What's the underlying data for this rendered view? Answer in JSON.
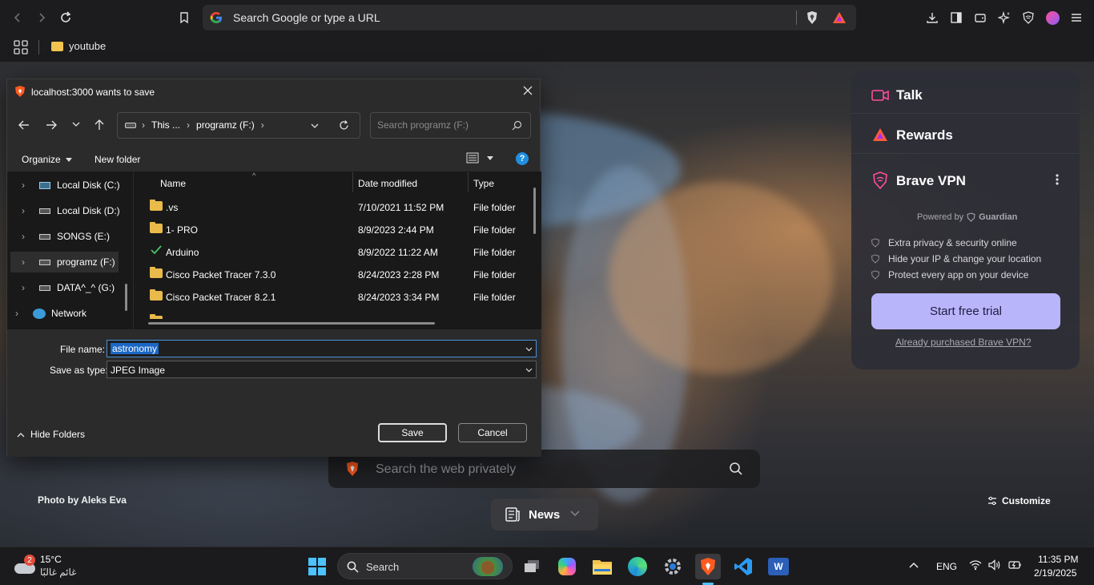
{
  "browser": {
    "url_placeholder": "Search Google or type a URL",
    "bookmark_folder": "youtube"
  },
  "background": {
    "photo_credit": "Photo by Aleks Eva",
    "customize_label": "Customize"
  },
  "brave_panel": {
    "talk_label": "Talk",
    "rewards_label": "Rewards",
    "vpn_title": "Brave VPN",
    "powered_by": "Powered by",
    "powered_brand": "Guardian",
    "features": [
      "Extra privacy & security online",
      "Hide your IP & change your location",
      "Protect every app on your device"
    ],
    "trial_button": "Start free trial",
    "purchased_link": "Already purchased Brave VPN?",
    "accent": "#b9b5fb"
  },
  "new_tab": {
    "search_placeholder": "Search the web privately",
    "news_label": "News"
  },
  "save_dialog": {
    "title": "localhost:3000 wants to save",
    "breadcrumb": [
      "This ...",
      "programz (F:)"
    ],
    "search_placeholder": "Search programz (F:)",
    "organize_label": "Organize",
    "new_folder_label": "New folder",
    "tree": [
      {
        "label": "Local Disk (C:)",
        "selected": false
      },
      {
        "label": "Local Disk (D:)",
        "selected": false
      },
      {
        "label": "SONGS (E:)",
        "selected": false
      },
      {
        "label": "programz (F:)",
        "selected": true
      },
      {
        "label": "DATA^_^ (G:)",
        "selected": false
      },
      {
        "label": "Network",
        "selected": false
      }
    ],
    "columns": {
      "name": "Name",
      "date": "Date modified",
      "type": "Type"
    },
    "files": [
      {
        "name": ".vs",
        "date": "7/10/2021 11:52 PM",
        "type": "File folder",
        "icon": "folder-icon"
      },
      {
        "name": "1- PRO",
        "date": "8/9/2023 2:44 PM",
        "type": "File folder",
        "icon": "folder-icon"
      },
      {
        "name": "Arduino",
        "date": "8/9/2022 11:22 AM",
        "type": "File folder",
        "icon": "sync-check-icon"
      },
      {
        "name": "Cisco Packet Tracer 7.3.0",
        "date": "8/24/2023 2:28 PM",
        "type": "File folder",
        "icon": "folder-icon"
      },
      {
        "name": "Cisco Packet Tracer 8.2.1",
        "date": "8/24/2023 3:34 PM",
        "type": "File folder",
        "icon": "folder-icon"
      }
    ],
    "file_name_label": "File name:",
    "file_name_value": "astronomy",
    "save_type_label": "Save as type:",
    "save_type_value": "JPEG Image",
    "hide_folders_label": "Hide Folders",
    "save_label": "Save",
    "cancel_label": "Cancel"
  },
  "taskbar": {
    "weather_temp": "15°C",
    "weather_desc": "غائم غالبًا",
    "weather_badge": "2",
    "search_label": "Search",
    "language": "ENG",
    "time": "11:35 PM",
    "date": "2/19/2025"
  }
}
